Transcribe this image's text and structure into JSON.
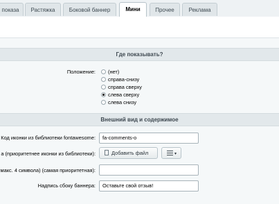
{
  "tabs": [
    {
      "label": "показа",
      "active": false
    },
    {
      "label": "Растяжка",
      "active": false
    },
    {
      "label": "Боковой баннер",
      "active": false
    },
    {
      "label": "Мини",
      "active": true
    },
    {
      "label": "Прочее",
      "active": false
    },
    {
      "label": "Реклама",
      "active": false
    }
  ],
  "where_section": {
    "title": "Где показывать?",
    "position_label": "Положение:",
    "options": [
      "(нет)",
      "справа-снизу",
      "справа сверху",
      "слева сверху",
      "слева снизу"
    ],
    "selected": "слева сверху"
  },
  "appearance_section": {
    "title": "Внешний вид и содержимое",
    "icon_code_label": "Код иконки из библиотеки fontawesome:",
    "icon_code_value": "fa-comments-o",
    "image_label": "а (приоритетнее иконки из библиотеки):",
    "add_file_label": "Добавить файл",
    "max_chars_label": "макс. 4 символа) (самая приоритетная):",
    "max_chars_value": "",
    "side_text_label": "Надпись сбоку баннера:",
    "side_text_value": "Оставьте свой отзыв!"
  }
}
